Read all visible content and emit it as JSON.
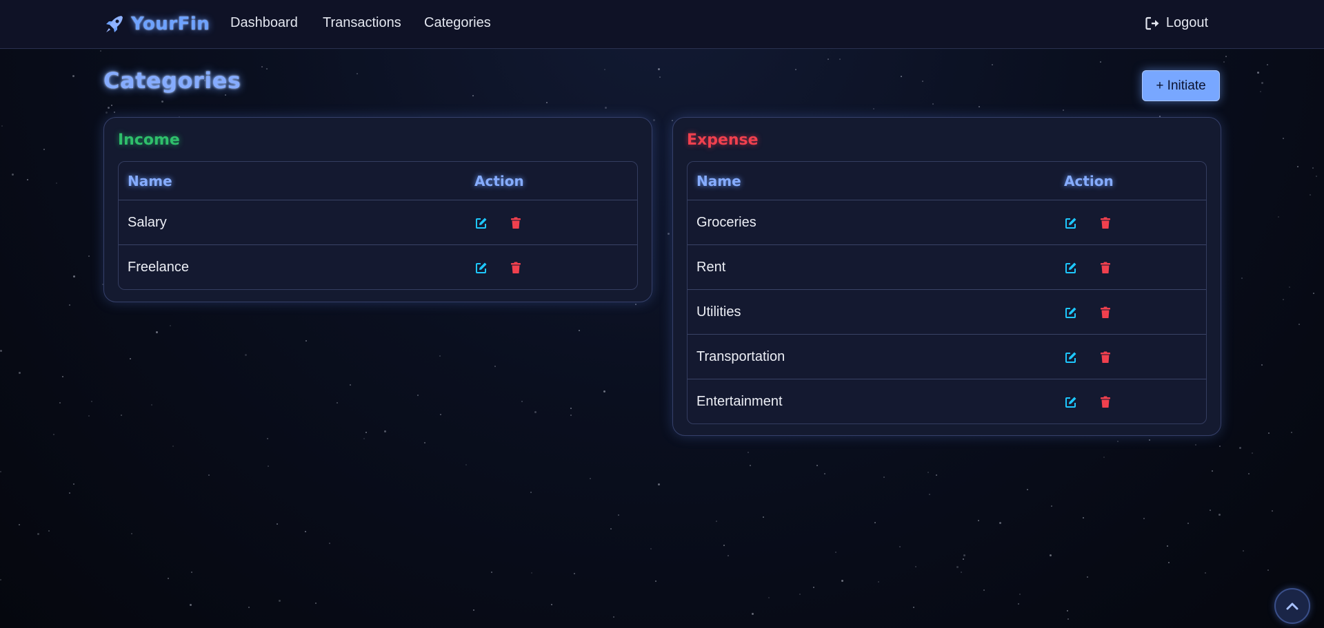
{
  "brand": {
    "name": "YourFin"
  },
  "nav": {
    "links": [
      "Dashboard",
      "Transactions",
      "Categories"
    ],
    "logout_label": "Logout"
  },
  "page": {
    "title": "Categories",
    "initiate_label": "+ Initiate"
  },
  "income": {
    "title": "Income",
    "columns": [
      "Name",
      "Action"
    ],
    "rows": [
      "Salary",
      "Freelance"
    ]
  },
  "expense": {
    "title": "Expense",
    "columns": [
      "Name",
      "Action"
    ],
    "rows": [
      "Groceries",
      "Rent",
      "Utilities",
      "Transportation",
      "Entertainment"
    ]
  },
  "icons": {
    "brand": "rocket-icon",
    "logout": "sign-out-icon",
    "edit": "edit-icon",
    "delete": "trash-icon",
    "scroll_top": "chevron-up-icon"
  },
  "colors": {
    "accent": "#78a7ff",
    "income": "#2fbf6b",
    "expense": "#f0404e",
    "edit_icon": "#1ec8ff",
    "delete_icon": "#f0404e"
  }
}
